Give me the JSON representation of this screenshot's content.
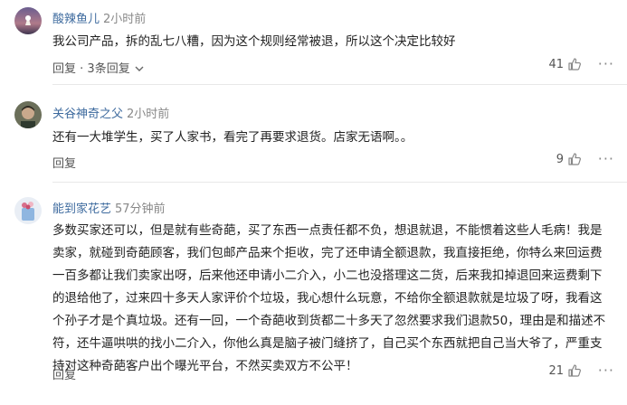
{
  "comments": [
    {
      "username": "酸辣鱼儿",
      "time": "2小时前",
      "text": "我公司产品，拆的乱七八糟，因为这个规则经常被退，所以这个决定比较好",
      "reply_label": "回复",
      "replies_label": "· 3条回复",
      "likes": "41",
      "avatar_icon": "sunset-avatar-icon"
    },
    {
      "username": "关谷神奇之父",
      "time": "2小时前",
      "text": "还有一大堆学生，买了人家书，看完了再要求退货。店家无语啊。。",
      "reply_label": "回复",
      "likes": "9",
      "avatar_icon": "portrait-avatar-icon"
    },
    {
      "username": "能到家花艺",
      "time": "57分钟前",
      "text": "多数买家还可以，但是就有些奇葩，买了东西一点责任都不负，想退就退，不能惯着这些人毛病！我是卖家，就碰到奇葩顾客，我们包邮产品来个拒收，完了还申请全额退款，我直接拒绝，你特么来回运费一百多都让我们卖家出呀，后来他还申请小二介入，小二也没搭理这二货，后来我扣掉退回来运费剩下的退给他了，过来四十多天人家评价个垃圾，我心想什么玩意，不给你全额退款就是垃圾了呀，我看这个孙子才是个真垃圾。还有一回，一个奇葩收到货都二十多天了忽然要求我们退款50，理由是和描述不符，还牛逼哄哄的找小二介入，你他么真是脑子被门缝挤了，自己买个东西就把自己当大爷了，严重支持对这种奇葩客户出个曝光平台，不然买卖双方不公平！",
      "reply_label": "回复",
      "likes": "21",
      "avatar_icon": "flower-avatar-icon"
    }
  ],
  "icons": {
    "like": "thumbs-up-icon",
    "more": "more-dots-icon"
  },
  "colors": {
    "username": "#3d6a9e",
    "meta": "#888888",
    "divider": "#e8e8e8"
  }
}
